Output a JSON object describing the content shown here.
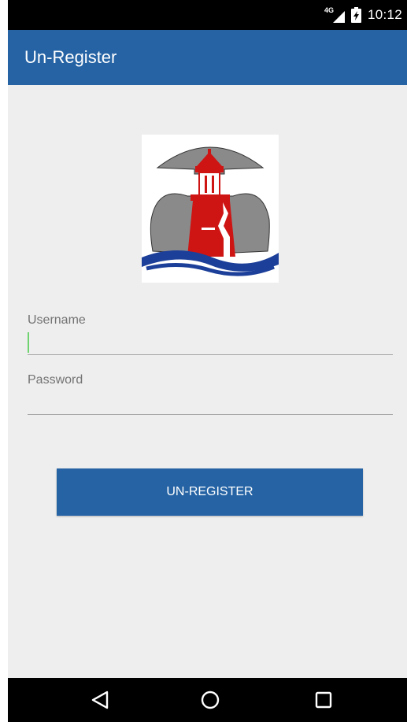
{
  "status_bar": {
    "network": "4G",
    "time": "10:12",
    "icons": [
      "signal-icon",
      "battery-icon"
    ]
  },
  "app_bar": {
    "title": "Un-Register"
  },
  "form": {
    "username": {
      "label": "Username",
      "value": ""
    },
    "password": {
      "label": "Password",
      "value": ""
    },
    "submit_label": "UN-REGISTER"
  },
  "nav_bar": {
    "icons": [
      "back-icon",
      "home-icon",
      "recents-icon"
    ]
  },
  "colors": {
    "primary": "#2563a4",
    "background": "#eeeeee",
    "focus": "#6fd36f",
    "logo_red": "#cf1414",
    "logo_gray": "#8a8a8a",
    "logo_blue": "#1c3f99"
  }
}
